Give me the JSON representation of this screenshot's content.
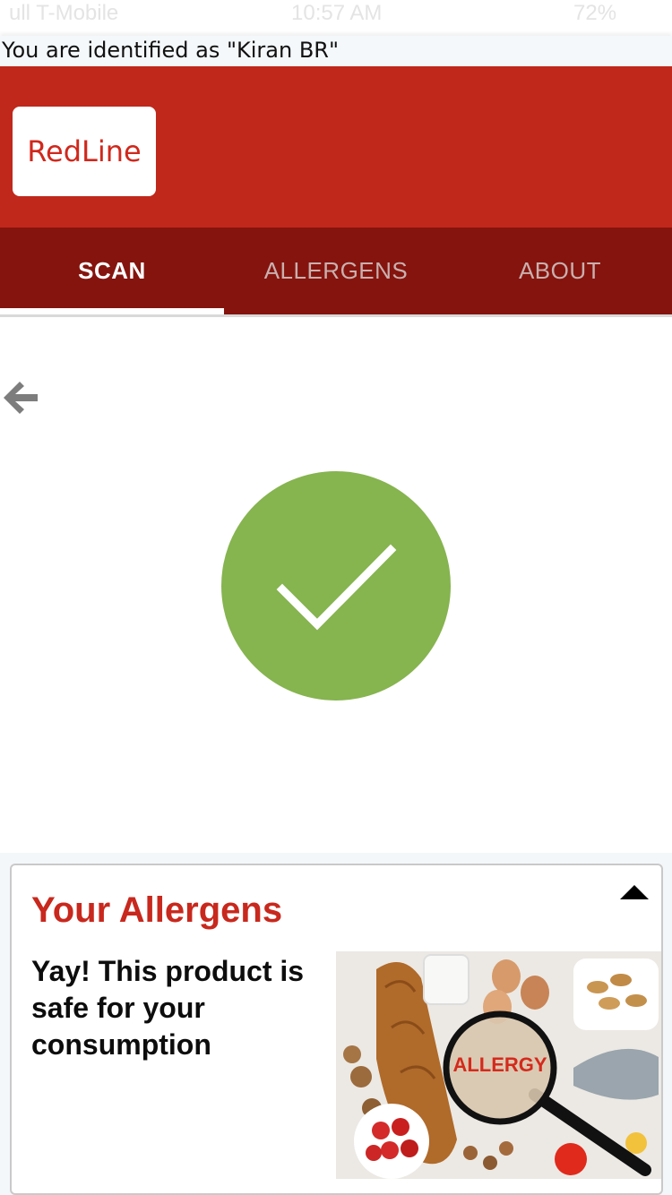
{
  "status_bar": {
    "carrier": "ull T-Mobile",
    "time": "10:57 AM",
    "battery": "72%"
  },
  "identity": {
    "text": "You are identified as \"Kiran BR\""
  },
  "header": {
    "logo_text": "RedLine",
    "brand_color": "#c0281c"
  },
  "tabs": [
    {
      "label": "SCAN",
      "active": true
    },
    {
      "label": "ALLERGENS",
      "active": false
    },
    {
      "label": "ABOUT",
      "active": false
    }
  ],
  "scan_result": {
    "icon": "checkmark-icon",
    "status_color": "#86b44f"
  },
  "allergens_panel": {
    "title": "Your Allergens",
    "message": "Yay! This product is safe for your consumption",
    "image_label": "ALLERGY",
    "toggle_icon": "triangle-up-icon"
  }
}
